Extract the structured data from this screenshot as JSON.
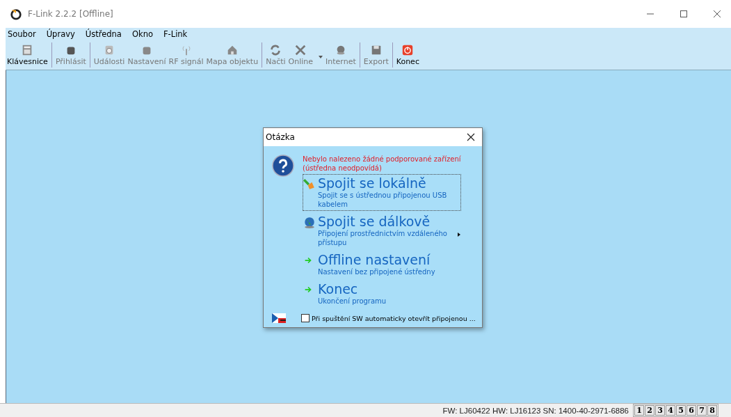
{
  "window": {
    "title": "F-Link 2.2.2 [Offline]"
  },
  "menu": [
    "Soubor",
    "Úpravy",
    "Ústředna",
    "Okno",
    "F-Link"
  ],
  "toolbar": [
    [
      {
        "label": "Klávesnice",
        "kind": "keypad",
        "disabled": false
      }
    ],
    [
      {
        "label": "Přihlásit",
        "kind": "login",
        "disabled": true
      }
    ],
    [
      {
        "label": "Události",
        "kind": "events",
        "disabled": true
      },
      {
        "label": "Nastavení",
        "kind": "settings",
        "disabled": true
      },
      {
        "label": "RF signál",
        "kind": "signal",
        "disabled": true
      },
      {
        "label": "Mapa objektu",
        "kind": "house",
        "disabled": true
      }
    ],
    [
      {
        "label": "Načti",
        "kind": "reload",
        "disabled": true
      },
      {
        "label": "Online",
        "kind": "online",
        "disabled": true,
        "dropdown": true
      },
      {
        "label": "Internet",
        "kind": "globe",
        "disabled": true
      }
    ],
    [
      {
        "label": "Export",
        "kind": "save",
        "disabled": true
      }
    ],
    [
      {
        "label": "Konec",
        "kind": "power",
        "disabled": false
      }
    ]
  ],
  "dialog": {
    "title": "Otázka",
    "message": "Nebylo nalezeno žádné podporované zařízení (ústředna neodpovídá)",
    "options": [
      {
        "kind": "plug",
        "title": "Spojit se lokálně",
        "description": "Spojit se s ústřednou připojenou USB kabelem",
        "focused": true,
        "submenu": false
      },
      {
        "kind": "globe",
        "title": "Spojit se dálkově",
        "description": "Připojení prostřednictvím vzdáleného přístupu",
        "focused": false,
        "submenu": true
      },
      {
        "kind": "arrow",
        "title": "Offline nastavení",
        "description": "Nastavení bez připojené ústředny",
        "focused": false,
        "submenu": false
      },
      {
        "kind": "arrow",
        "title": "Konec",
        "description": "Ukončení programu",
        "focused": false,
        "submenu": false
      }
    ],
    "checkbox": {
      "label": "Při spuštění SW automaticky otevřít připojenou ...",
      "checked": false
    }
  },
  "status_bar": {
    "info": "FW: LJ60422 HW: LJ16123 SN: 1400-40-2971-6886",
    "pages": [
      "1",
      "2",
      "3",
      "4",
      "5",
      "6",
      "7",
      "8"
    ]
  }
}
